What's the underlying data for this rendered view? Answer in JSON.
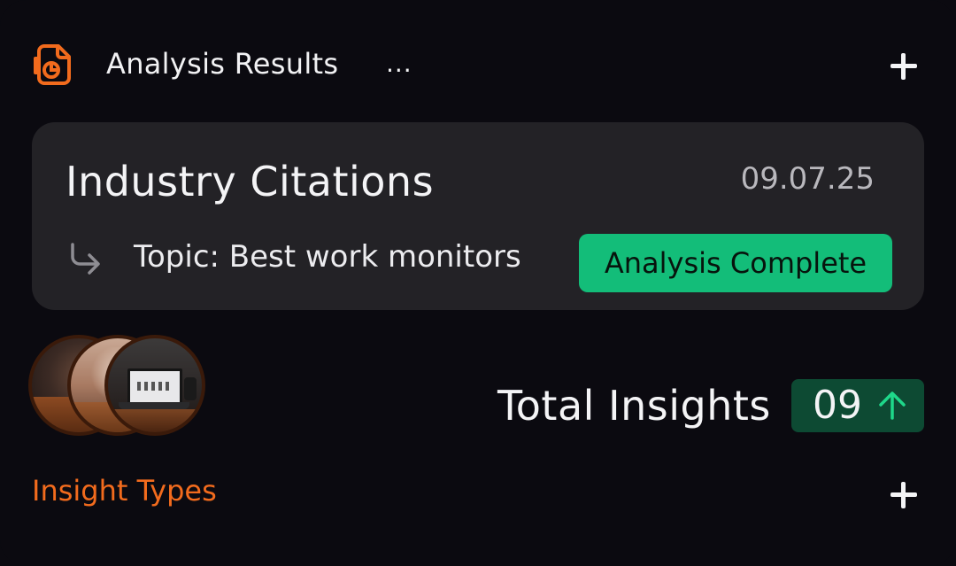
{
  "header": {
    "icon": "document-chart-icon",
    "title": "Analysis Results",
    "more": "...",
    "add_icon": "plus-icon"
  },
  "citation": {
    "title": "Industry Citations",
    "date": "09.07.25",
    "topic": "Topic: Best work monitors",
    "status": "Analysis Complete",
    "arrow_icon": "return-arrow-icon"
  },
  "insights": {
    "label": "Total Insights",
    "count": "09",
    "trend_icon": "arrow-up-icon"
  },
  "footer": {
    "label": "Insight Types",
    "add_icon": "plus-icon"
  },
  "colors": {
    "background": "#0b0a10",
    "panel": "#232226",
    "accent_orange": "#f26b1d",
    "status_green": "#13bd79",
    "count_badge_green": "#0d4a33",
    "trend_green": "#1ed88a"
  }
}
